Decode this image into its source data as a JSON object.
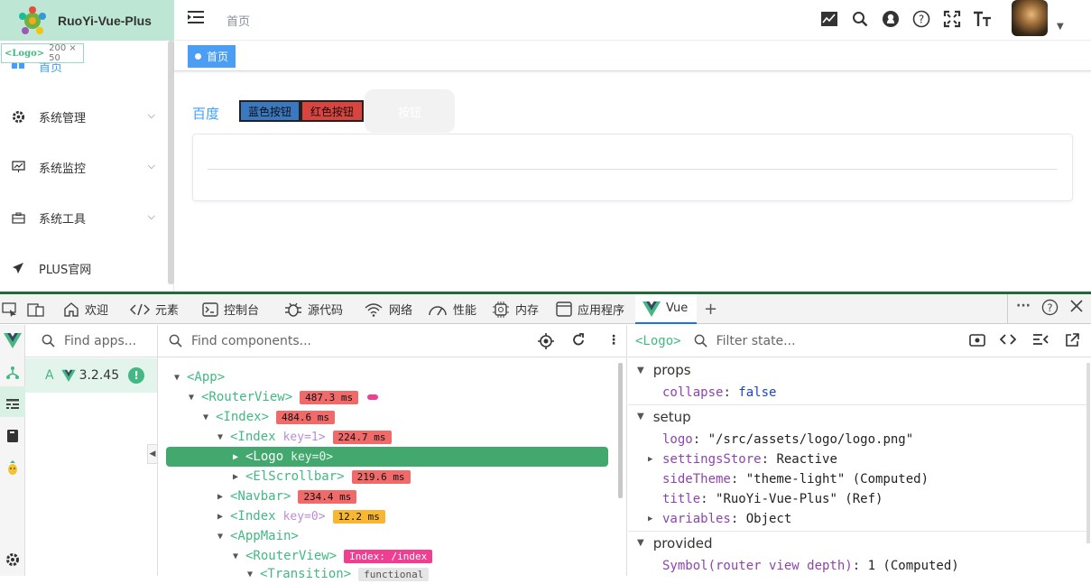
{
  "app": {
    "logo_title": "RuoYi-Vue-Plus",
    "logo_tooltip_tag": "<Logo>",
    "logo_tooltip_size": "200 × 50",
    "menu": [
      {
        "label": "首页",
        "icon": "dashboard-icon"
      },
      {
        "label": "系统管理",
        "icon": "gear-icon"
      },
      {
        "label": "系统监控",
        "icon": "monitor-icon"
      },
      {
        "label": "系统工具",
        "icon": "toolbox-icon"
      },
      {
        "label": "PLUS官网",
        "icon": "send-icon"
      }
    ],
    "breadcrumb": "首页",
    "tag_home": "首页",
    "baidu_link": "百度",
    "blue_button": "蓝色按钮",
    "red_button": "红色按钮",
    "gray_button": "按钮",
    "toolbar_icons": [
      "chart-icon",
      "search-icon",
      "github-icon",
      "help-icon",
      "fullscreen-icon",
      "text-size-icon"
    ]
  },
  "devtools": {
    "tabs": [
      {
        "label": "欢迎",
        "icon": "home-icon"
      },
      {
        "label": "元素",
        "icon": "code-icon"
      },
      {
        "label": "控制台",
        "icon": "console-icon"
      },
      {
        "label": "源代码",
        "icon": "bug-icon"
      },
      {
        "label": "网络",
        "icon": "wifi-icon"
      },
      {
        "label": "性能",
        "icon": "gauge-icon"
      },
      {
        "label": "内存",
        "icon": "chip-icon"
      },
      {
        "label": "应用程序",
        "icon": "app-icon"
      },
      {
        "label": "Vue",
        "icon": "vue-icon"
      }
    ],
    "apps_placeholder": "Find apps...",
    "app_entry_letter": "A",
    "app_entry_version": "3.2.45",
    "components_placeholder": "Find components...",
    "tree": [
      {
        "name": "<App>",
        "arrow": "▼"
      },
      {
        "name": "<RouterView>",
        "arrow": "▼",
        "ms": "487.3 ms"
      },
      {
        "name": "<Index>",
        "arrow": "▼",
        "ms": "484.6 ms"
      },
      {
        "name": "<Index",
        "arrow": "▼",
        "key": "key=1>",
        "ms": "224.7 ms"
      },
      {
        "name": "<Logo",
        "arrow": "▶",
        "key": "key=0>"
      },
      {
        "name": "<ElScrollbar>",
        "arrow": "▶",
        "ms": "219.6 ms"
      },
      {
        "name": "<Navbar>",
        "arrow": "▶",
        "ms": "234.4 ms"
      },
      {
        "name": "<Index",
        "arrow": "▶",
        "key": "key=0>",
        "ms": "12.2 ms"
      },
      {
        "name": "<AppMain>",
        "arrow": "▼"
      },
      {
        "name": "<RouterView>",
        "arrow": "▼",
        "ms": "Index: /index"
      },
      {
        "name": "<Transition>",
        "arrow": "▼",
        "ms": "functional"
      }
    ],
    "state_component": "<Logo>",
    "state_placeholder": "Filter state...",
    "sections": {
      "props": "props",
      "setup": "setup",
      "provided": "provided"
    },
    "props": [
      {
        "key": "collapse",
        "value": "false"
      }
    ],
    "setup": [
      {
        "key": "logo",
        "value": "\"/src/assets/logo/logo.png\""
      },
      {
        "key": "settingsStore",
        "value": "Reactive"
      },
      {
        "key": "sideTheme",
        "value": "\"theme-light\" (Computed)"
      },
      {
        "key": "title",
        "value": "\"RuoYi-Vue-Plus\" (Ref)"
      },
      {
        "key": "variables",
        "value": "Object"
      }
    ],
    "provided": [
      {
        "key": "Symbol(router view depth)",
        "value": "1 (Computed)"
      }
    ]
  },
  "colors": {
    "vue_green": "#42b883",
    "logo_bar": "#bde6d5",
    "tag_blue": "#4a9ff5",
    "ms_red": "#f06a6a",
    "ms_yellow": "#f7b733"
  }
}
